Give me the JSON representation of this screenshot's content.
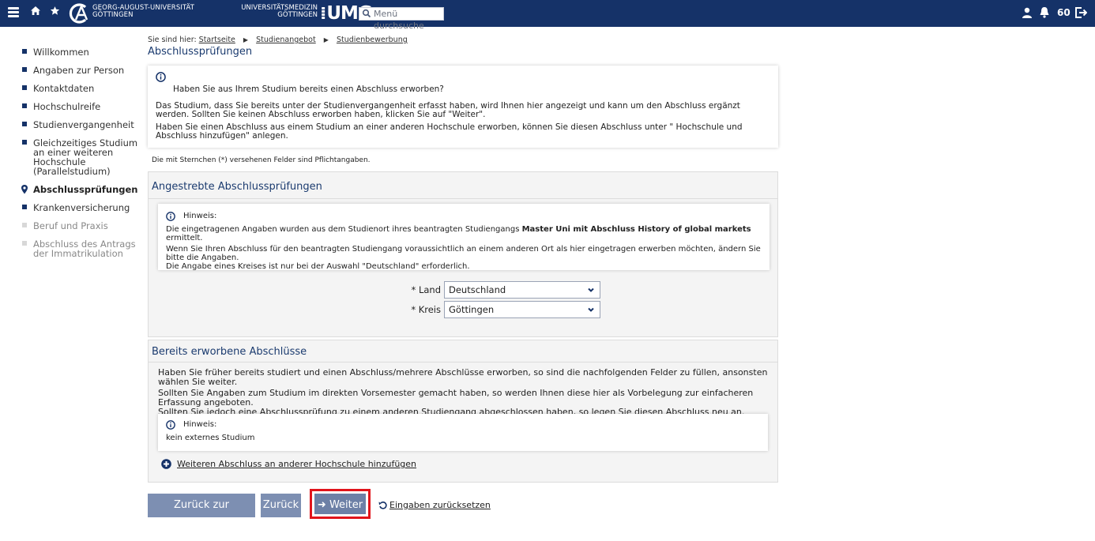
{
  "topbar": {
    "university_line1": "GEORG-AUGUST-UNIVERSITÄT",
    "university_line2": "GÖTTINGEN",
    "umg_line1": "UNIVERSITÄTSMEDIZIN",
    "umg_line2": "GÖTTINGEN",
    "umg_mark": "UMG",
    "search_placeholder": "Menü durchsuche",
    "notification_count": "60",
    "icons": [
      "menu-icon",
      "home-icon",
      "star-icon",
      "search-icon",
      "user-icon",
      "bell-icon",
      "logout-icon"
    ],
    "bg_color": "#153268"
  },
  "breadcrumb": {
    "prefix": "Sie sind hier:",
    "items": [
      "Startseite",
      "Studienangebot",
      "Studienbewerbung"
    ]
  },
  "page_title": "Abschlussprüfungen",
  "sidebar": {
    "items": [
      {
        "label": "Willkommen",
        "state": "enabled"
      },
      {
        "label": "Angaben zur Person",
        "state": "enabled"
      },
      {
        "label": "Kontaktdaten",
        "state": "enabled"
      },
      {
        "label": "Hochschulreife",
        "state": "enabled"
      },
      {
        "label": "Studienvergangenheit",
        "state": "enabled"
      },
      {
        "label": "Gleichzeitiges Studium an einer weiteren Hochschule (Parallelstudium)",
        "state": "enabled"
      },
      {
        "label": "Abschlussprüfungen",
        "state": "active"
      },
      {
        "label": "Krankenversicherung",
        "state": "enabled"
      },
      {
        "label": "Beruf und Praxis",
        "state": "disabled"
      },
      {
        "label": "Abschluss des Antrags der Immatrikulation",
        "state": "disabled"
      }
    ]
  },
  "intro": {
    "question": "Haben Sie aus Ihrem Studium bereits einen Abschluss erworben?",
    "para1": "Das Studium, dass Sie bereits unter der Studienvergangenheit erfasst haben, wird Ihnen hier angezeigt und kann um den Abschluss ergänzt werden. Sollten Sie keinen Abschluss erworben haben, klicken Sie auf \"Weiter\".",
    "para2": "Haben Sie einen Abschluss aus einem Studium an einer anderen Hochschule erworben, können Sie diesen Abschluss unter \" Hochschule und Abschluss hinzufügen\" anlegen."
  },
  "required_note": "Die mit Sternchen (*) versehenen Felder sind Pflichtangaben.",
  "panel_target": {
    "title": "Angestrebte Abschlussprüfungen",
    "hint_label": "Hinweis:",
    "hint_line1_before": "Die eingetragenen Angaben wurden aus dem Studienort ihres beantragten Studiengangs ",
    "hint_line1_bold": "Master Uni mit Abschluss History of global markets",
    "hint_line1_after": " ermittelt.",
    "hint_line2": "Wenn Sie Ihren Abschluss für den beantragten Studiengang voraussichtlich an einem anderen Ort als hier eingetragen erwerben möchten, ändern Sie bitte die Angaben.",
    "hint_line3": "Die Angabe eines Kreises ist nur bei der Auswahl \"Deutschland\" erforderlich.",
    "land_label": "* Land",
    "land_value": "Deutschland",
    "kreis_label": "* Kreis",
    "kreis_value": "Göttingen"
  },
  "panel_existing": {
    "title": "Bereits erworbene Abschlüsse",
    "text1": "Haben Sie früher bereits studiert und einen Abschluss/mehrere Abschlüsse erworben, so sind die nachfolgenden Felder zu füllen, ansonsten wählen Sie weiter.",
    "text2": "Sollten Sie Angaben zum Studium im direkten Vorsemester gemacht haben, so werden Ihnen diese hier als Vorbelegung zur einfacheren Erfassung angeboten.",
    "text3": "Sollten Sie jedoch eine Abschlussprüfung zu einem anderen Studiengang abgeschlossen haben, so legen Sie diesen Abschluss neu an.",
    "hint_label": "Hinweis:",
    "hint_text": "kein externes Studium",
    "add_link": "Weiteren Abschluss an anderer Hochschule hinzufügen"
  },
  "actions": {
    "overview": "Zurück zur Übersicht",
    "back": "Zurück",
    "next": "Weiter",
    "reset": "Eingaben zurücksetzen"
  }
}
